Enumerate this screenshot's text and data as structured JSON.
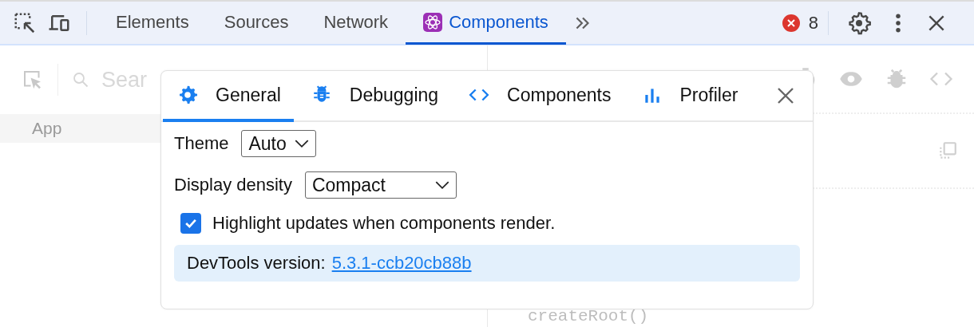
{
  "toolbar": {
    "tabs": [
      {
        "label": "Elements",
        "selected": false,
        "kind": "plain"
      },
      {
        "label": "Sources",
        "selected": false,
        "kind": "plain"
      },
      {
        "label": "Network",
        "selected": false,
        "kind": "plain"
      },
      {
        "label": "Components",
        "selected": true,
        "kind": "react"
      }
    ],
    "error_count": "8"
  },
  "components_panel": {
    "search": {
      "placeholder": "Sear"
    },
    "tree": [
      {
        "label": "App"
      }
    ],
    "code": "createRoot()"
  },
  "settings_dialog": {
    "tabs": [
      {
        "label": "General",
        "selected": true,
        "kind": "gear"
      },
      {
        "label": "Debugging",
        "selected": false,
        "kind": "bug"
      },
      {
        "label": "Components",
        "selected": false,
        "kind": "code"
      },
      {
        "label": "Profiler",
        "selected": false,
        "kind": "chart"
      }
    ],
    "theme": {
      "label": "Theme",
      "value": "Auto"
    },
    "density": {
      "label": "Display density",
      "value": "Compact"
    },
    "highlight": {
      "label": "Highlight updates when components render.",
      "checked": true
    },
    "version": {
      "label": "DevTools version:",
      "link": "5.3.1-ccb20cb88b"
    }
  }
}
